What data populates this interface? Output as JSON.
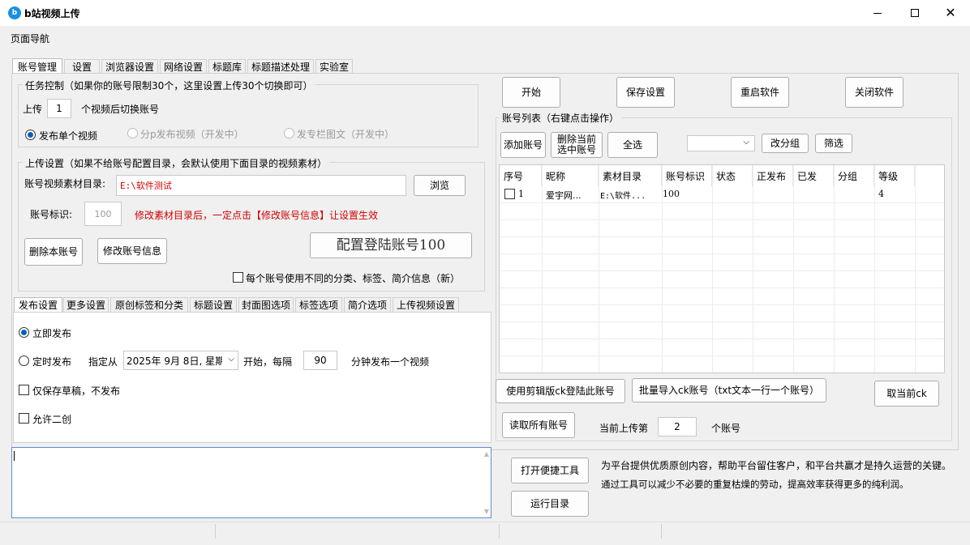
{
  "window": {
    "title": "b站视频上传"
  },
  "menu": {
    "nav": "页面导航"
  },
  "top_tabs": [
    "账号管理",
    "设置",
    "浏览器设置",
    "网络设置",
    "标题库",
    "标题描述处理",
    "实验室"
  ],
  "task": {
    "group_label": "任务控制（如果你的账号限制30个，这里设置上传30个切换即可）",
    "upload_prefix": "上传",
    "upload_count": "1",
    "upload_suffix": "个视频后切换账号",
    "radio_single": "发布单个视频",
    "radio_multi": "分p发布视频（开发中）",
    "radio_column": "发专栏图文（开发中）"
  },
  "upload": {
    "group_label": "上传设置（如果不给账号配置目录，会默认使用下面目录的视频素材）",
    "dir_label": "账号视频素材目录:",
    "dir_value": "E:\\软件测试",
    "browse": "浏览",
    "id_label": "账号标识:",
    "id_value": "100",
    "warn": "修改素材目录后，一定点击【修改账号信息】让设置生效",
    "delete_btn": "删除本账号",
    "modify_btn": "修改账号信息",
    "config_btn": "配置登陆账号100",
    "per_account": "每个账号使用不同的分类、标签、简介信息（新）"
  },
  "bottom_tabs": [
    "发布设置",
    "更多设置",
    "原创标签和分类",
    "标题设置",
    "封面图选项",
    "标签选项",
    "简介选项",
    "上传视频设置"
  ],
  "publish": {
    "now": "立即发布",
    "timed": "定时发布",
    "from_label": "指定从",
    "date": "2025年 9月 8日, 星期",
    "start_every": "开始，每隔",
    "interval": "90",
    "interval_suffix": "分钟发布一个视频",
    "draft": "仅保存草稿，不发布",
    "allow": "允许二创"
  },
  "actions": {
    "start": "开始",
    "save": "保存设置",
    "restart": "重启软件",
    "close": "关闭软件"
  },
  "accounts": {
    "group_label": "账号列表（右键点击操作）",
    "add": "添加账号",
    "delete_selected": "删除当前选中账号",
    "select_all": "全选",
    "group_btn": "改分组",
    "filter_btn": "筛选",
    "columns": [
      "序号",
      "昵称",
      "素材目录",
      "账号标识",
      "状态",
      "正发布",
      "已发",
      "分组",
      "等级"
    ],
    "rows": [
      {
        "no": "1",
        "nick": "爱宇网...",
        "dir": "E:\\软件...",
        "id": "100",
        "status": "",
        "pub": "",
        "done": "",
        "group": "",
        "level": "4"
      }
    ],
    "ck_login": "使用剪辑版ck登陆此账号",
    "batch_import": "批量导入ck账号（txt文本一行一个账号）",
    "cancel_ck": "取当前ck",
    "read_all": "读取所有账号",
    "current_prefix": "当前上传第",
    "current_value": "2",
    "current_suffix": "个账号"
  },
  "bottom": {
    "open_tools": "打开便捷工具",
    "run_dir": "运行目录",
    "line1": "为平台提供优质原创内容，帮助平台留住客户，和平台共赢才是持久运营的关键。",
    "line2": "通过工具可以减少不必要的重复枯燥的劳动，提高效率获得更多的纯利润。"
  }
}
